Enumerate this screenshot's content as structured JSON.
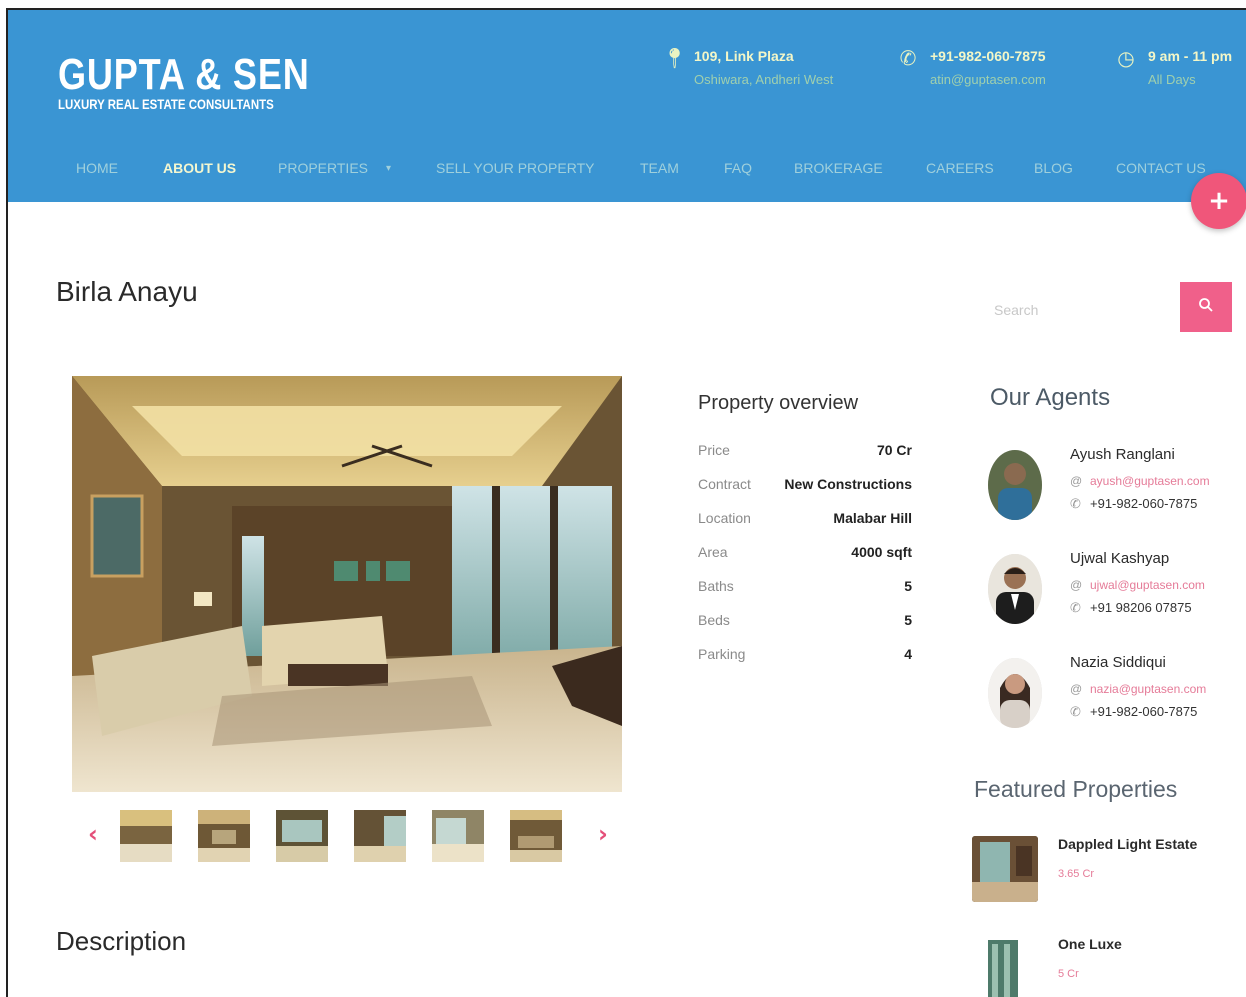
{
  "header": {
    "brand_name": "GUPTA & SEN",
    "brand_tagline": "LUXURY REAL ESTATE CONSULTANTS",
    "background_color": "#3a95d3",
    "address": {
      "icon": "map-pin-icon",
      "line1": "109, Link Plaza",
      "line2": "Oshiwara, Andheri West"
    },
    "contact": {
      "icon": "phone-icon",
      "line1": "+91-982-060-7875",
      "line2": "atin@guptasen.com"
    },
    "hours": {
      "icon": "clock-icon",
      "line1": "9 am - 11 pm",
      "line2": "All Days"
    }
  },
  "nav": {
    "items": [
      {
        "label": "HOME"
      },
      {
        "label": "ABOUT US"
      },
      {
        "label": "PROPERTIES"
      },
      {
        "label": "SELL YOUR PROPERTY"
      },
      {
        "label": "TEAM"
      },
      {
        "label": "FAQ"
      },
      {
        "label": "BROKERAGE"
      },
      {
        "label": "CAREERS"
      },
      {
        "label": "BLOG"
      },
      {
        "label": "CONTACT US"
      }
    ],
    "active": "ABOUT US",
    "dropdown_icon": "caret-down-icon"
  },
  "fab": {
    "symbol": "+",
    "color": "#f0567a"
  },
  "page": {
    "title": "Birla Anayu"
  },
  "search": {
    "placeholder": "Search",
    "button_icon": "search-icon",
    "accent": "#f0608a"
  },
  "gallery": {
    "prev": "‹",
    "next": "›",
    "thumb_count": 6
  },
  "overview": {
    "title": "Property overview",
    "rows": [
      {
        "label": "Price",
        "value": "70 Cr"
      },
      {
        "label": "Contract",
        "value": "New Constructions"
      },
      {
        "label": "Location",
        "value": "Malabar Hill"
      },
      {
        "label": "Area",
        "value": "4000 sqft"
      },
      {
        "label": "Baths",
        "value": "5"
      },
      {
        "label": "Beds",
        "value": "5"
      },
      {
        "label": "Parking",
        "value": "4"
      }
    ]
  },
  "agents": {
    "title": "Our Agents",
    "items": [
      {
        "name": "Ayush Ranglani",
        "email": "ayush@guptasen.com",
        "phone": "+91-982-060-7875"
      },
      {
        "name": "Ujwal Kashyap",
        "email": "ujwal@guptasen.com",
        "phone": "+91 98206 07875"
      },
      {
        "name": "Nazia Siddiqui",
        "email": "nazia@guptasen.com",
        "phone": "+91-982-060-7875"
      }
    ]
  },
  "featured": {
    "title": "Featured Properties",
    "items": [
      {
        "name": "Dappled Light Estate",
        "price": "3.65 Cr"
      },
      {
        "name": "One Luxe",
        "price": "5 Cr"
      }
    ]
  },
  "description": {
    "title": "Description"
  }
}
